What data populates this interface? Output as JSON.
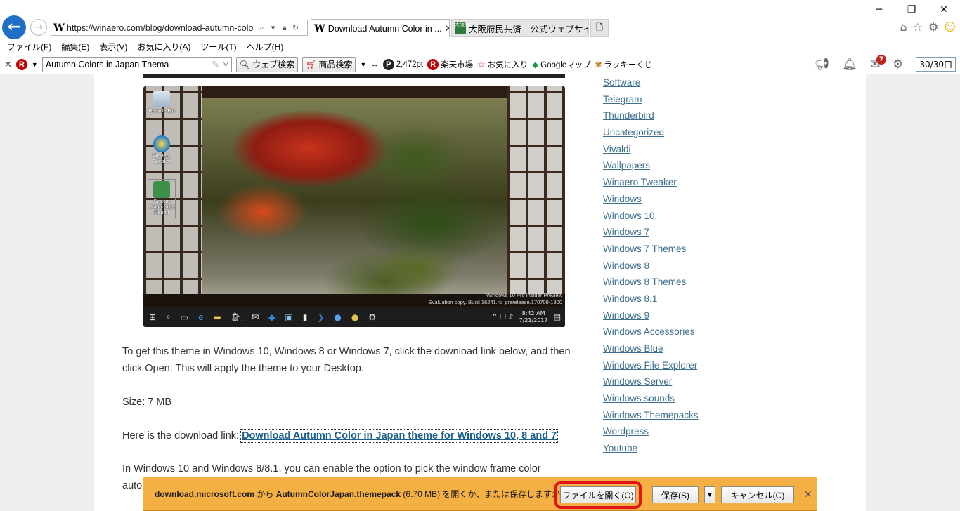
{
  "window": {
    "minimize": "─",
    "restore": "❐",
    "close": "✕"
  },
  "nav": {
    "back_glyph": "←",
    "forward_glyph": "→"
  },
  "address": {
    "url": "https://winaero.com/blog/download-autumn-colo",
    "favicon": "W"
  },
  "tabs": [
    {
      "title": "Download Autumn Color in ...",
      "favicon": "W",
      "active": true
    },
    {
      "title": "大阪府民共済　公式ウェブサイト",
      "favicon": "大阪府民",
      "active": false
    }
  ],
  "menu": [
    "ファイル(F)",
    "編集(E)",
    "表示(V)",
    "お気に入り(A)",
    "ツール(T)",
    "ヘルプ(H)"
  ],
  "toolbar": {
    "search_value": "Autumn Colors in Japan Thema",
    "web_search": "ウェブ検索",
    "product_search": "商品検索",
    "points": "2,472pt",
    "rakuten": "楽天市場",
    "favorites": "お気に入り",
    "googlemap": "Googleマップ",
    "lucky": "ラッキーくじ",
    "mail_badge": "7",
    "tab_count": "30/30口"
  },
  "screenshot": {
    "recycle": "Recycle Bin",
    "tweaker": "Winaero Tweaker",
    "diag": "System Diagnostics Report",
    "wm1": "Windows 10 Pro Insider Preview",
    "wm2": "Evaluation copy. Build 16241.rs_prerelease.170708-1800",
    "time": "8:42 AM",
    "date": "7/21/2017"
  },
  "article": {
    "p1": "To get this theme in Windows 10, Windows 8 or Windows 7, click the download link below, and then click Open. This will apply the theme to your Desktop.",
    "size": "Size: 7 MB",
    "link_prefix": "Here is the download link: ",
    "link": "Download Autumn Color in Japan theme for Windows 10, 8 and 7",
    "p3": "In Windows 10 and Windows 8/8.1, you can enable the option to pick the window frame color",
    "p3b": "auto"
  },
  "sidebar": [
    "Software",
    "Telegram",
    "Thunderbird",
    "Uncategorized",
    "Vivaldi",
    "Wallpapers",
    "Winaero Tweaker",
    "Windows",
    "Windows 10",
    "Windows 7",
    "Windows 7 Themes",
    "Windows 8",
    "Windows 8 Themes",
    "Windows 8.1",
    "Windows 9",
    "Windows Accessories",
    "Windows Blue",
    "Windows File Explorer",
    "Windows Server",
    "Windows sounds",
    "Windows Themepacks",
    "Wordpress",
    "Youtube"
  ],
  "download": {
    "host": "download.microsoft.com",
    "from": " から ",
    "file": "AutumnColorJapan.themepack",
    "size": " (6.70 MB) ",
    "question": "を開くか、または保存しますか?",
    "open": "ファイルを開く(O)",
    "save": "保存(S)",
    "cancel": "キャンセル(C)",
    "close": "✕"
  },
  "colors": {
    "accent": "#1f6fc5",
    "dlbar": "#f5b043",
    "highlight_ring": "#e0151b",
    "link": "#3d6f8d"
  }
}
